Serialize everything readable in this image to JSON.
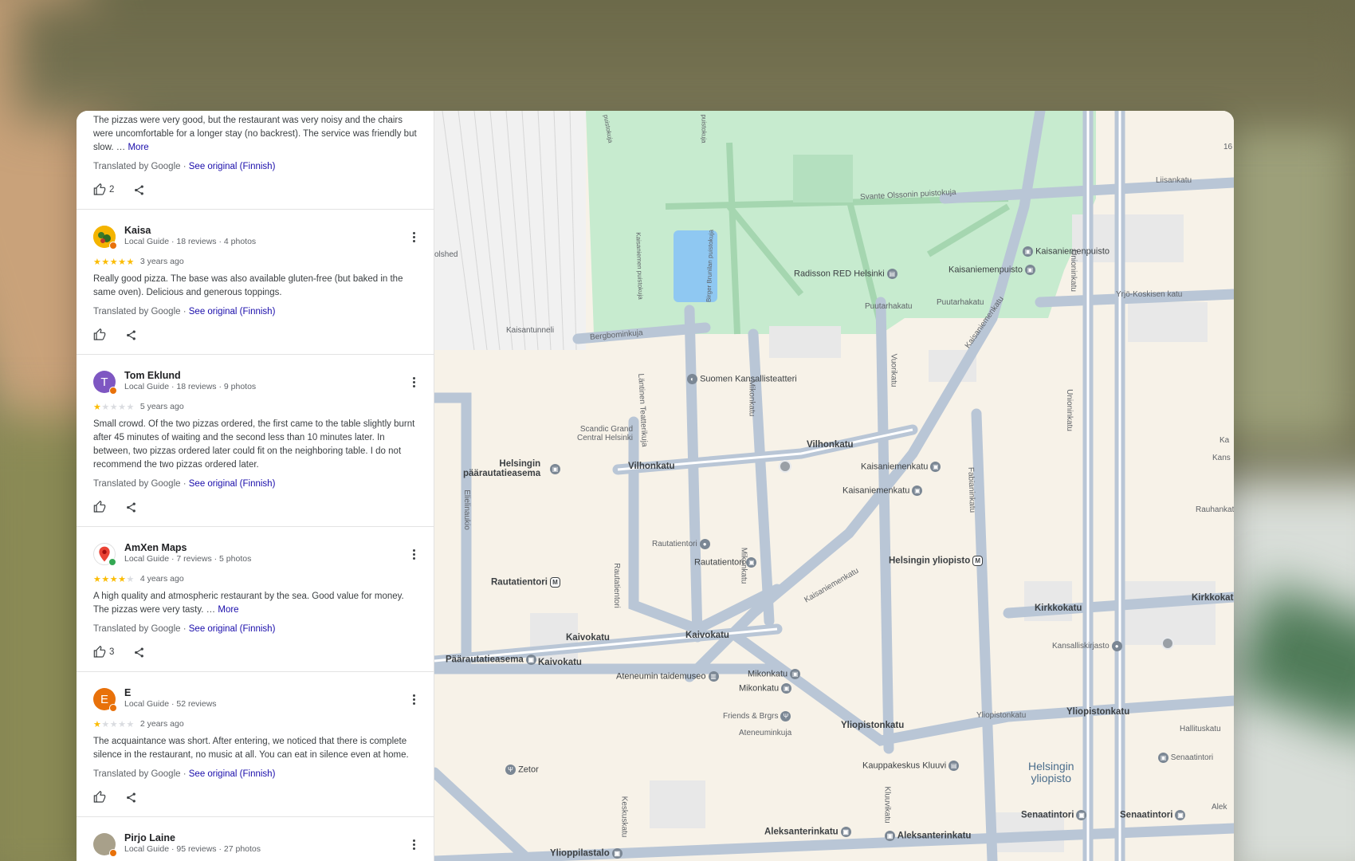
{
  "colors": {
    "accent_link": "#1a0dab",
    "star": "#fbbc04",
    "park": "#c7ebcf",
    "water": "#8fc8f2",
    "road": "#b9c6d6"
  },
  "reviews": [
    {
      "name": "",
      "meta": "",
      "stars": 0,
      "when": "",
      "text": "The pizzas were very good, but the restaurant was very noisy and the chairs were uncomfortable for a longer stay (no backrest). The service was friendly but slow. …",
      "more": "More",
      "translated_prefix": "Translated by Google · ",
      "see_original": "See original (Finnish)",
      "likes": "2"
    },
    {
      "name": "Kaisa",
      "meta": "Local Guide · 18 reviews · 4 photos",
      "stars": 5,
      "when": "3 years ago",
      "text": "Really good pizza. The base was also available gluten-free (but baked in the same oven). Delicious and generous toppings.",
      "more": "",
      "translated_prefix": "Translated by Google · ",
      "see_original": "See original (Finnish)",
      "likes": "",
      "avatar": {
        "letter": "",
        "color": "#f4b400"
      }
    },
    {
      "name": "Tom Eklund",
      "meta": "Local Guide · 18 reviews · 9 photos",
      "stars": 1,
      "when": "5 years ago",
      "text": "Small crowd. Of the two pizzas ordered, the first came to the table slightly burnt after 45 minutes of waiting and the second less than 10 minutes later. In between, two pizzas ordered later could fit on the neighboring table. I do not recommend the two pizzas ordered later.",
      "more": "",
      "translated_prefix": "Translated by Google · ",
      "see_original": "See original (Finnish)",
      "likes": "",
      "avatar": {
        "letter": "T",
        "color": "#7e57c2"
      }
    },
    {
      "name": "AmXen Maps",
      "meta": "Local Guide · 7 reviews · 5 photos",
      "stars": 4,
      "when": "4 years ago",
      "text": "A high quality and atmospheric restaurant by the sea. Good value for money. The pizzas were very tasty. …",
      "more": "More",
      "translated_prefix": "Translated by Google · ",
      "see_original": "See original (Finnish)",
      "likes": "3",
      "avatar": {
        "letter": "",
        "color": "#ffffff"
      }
    },
    {
      "name": "E",
      "meta": "Local Guide · 52 reviews",
      "stars": 1,
      "when": "2 years ago",
      "text": "The acquaintance was short. After entering, we noticed that there is complete silence in the restaurant, no music at all. You can eat in silence even at home.",
      "more": "",
      "translated_prefix": "Translated by Google · ",
      "see_original": "See original (Finnish)",
      "likes": "",
      "avatar": {
        "letter": "E",
        "color": "#e8710a"
      }
    },
    {
      "name": "Pirjo Laine",
      "meta": "Local Guide · 95 reviews · 27 photos",
      "avatar": {
        "letter": "",
        "color": "#a8a08a"
      }
    }
  ],
  "map": {
    "labels": {
      "liisankatu": "Liisankatu",
      "kaisaniemenpuisto": "Kaisaniemenpuisto",
      "kaisaniemenpuisto2": "Kaisaniemenpuisto",
      "svante": "Svante Olssonin puistokuja",
      "radisson": "Radisson RED Helsinki",
      "puutarhakatu": "Puutarhakatu",
      "puutarhakatu2": "Puutarhakatu",
      "yrjo": "Yrjö-Koskisen katu",
      "bergbomin": "Bergbominkuja",
      "kaisantunneli": "Kaisantunneli",
      "olshed": "olshed",
      "lantinen": "Läntinen Teatterikuja",
      "suomen": "Suomen Kansallisteatteri",
      "vuorikatu": "Vuorikatu",
      "mikonkatu": "Mikonkatu",
      "scandic": "Scandic Grand\nCentral Helsinki",
      "vilhonkatu": "Vilhonkatu",
      "vilhonkatu2": "Vilhonkatu",
      "kaisaniemenkatu": "Kaisaniemenkatu",
      "kaisaniemenkatu2": "Kaisaniemenkatu",
      "kaisaniemenkatu_st": "Kaisaniemenkatu",
      "kaisaniemenkatu_st2": "Kaisaniemenkatu",
      "fabianinkatu": "Fabianinkatu",
      "unioninkatu": "Unioninkatu",
      "helsingin_pr": "Helsingin\npäärautatieasema",
      "elielinaukio": "Elielinaukio",
      "rautatientori": "Rautatientori",
      "rautatientori2": "Rautatientori",
      "rautatientori3": "Rautatientori",
      "rautatientori_st": "Rautatientori",
      "mikonkatu2": "Mikonkatu",
      "helsingin_yliopisto": "Helsingin yliopisto",
      "kirkkokatu": "Kirkkokatu",
      "kirkkokatu2": "Kirkkokatu",
      "rauhankatu": "Rauhankatu",
      "kaivokatu": "Kaivokatu",
      "kaivokatu2": "Kaivokatu",
      "kaivokatu3": "Kaivokatu",
      "paarautatieasema": "Päärautatieasema",
      "ateneumin": "Ateneumin taidemuseo",
      "mikonkatu3": "Mikonkatu",
      "mikonkatu4": "Mikonkatu",
      "kansalliskirjasto": "Kansalliskirjasto",
      "friends": "Friends & Brgrs",
      "ateneuminkuja": "Ateneuminkuja",
      "yliopistonkatu": "Yliopistonkatu",
      "yliopistonkatu2": "Yliopistonkatu",
      "yliopistonkatu3": "Yliopistonkatu",
      "hallituskatu": "Hallituskatu",
      "senaatintori": "Senaatintori",
      "senaatintori2": "Senaatintori",
      "senaatintori3": "Senaatintori",
      "zetor": "Zetor",
      "kauppakeskus": "Kauppakeskus Kluuvi",
      "helsingin_area": "Helsingin\nyliopisto",
      "keskuskatu": "Keskuskatu",
      "kluuvikatu": "Kluuvikatu",
      "aleksanterinkatu": "Aleksanterinkatu",
      "aleksanterinkatu2": "Aleksanterinkatu",
      "ylioppilastalo": "Ylioppilastalo",
      "kans": "Kans",
      "ka": "Ka",
      "alek": "Alek",
      "n16": "16",
      "kaisaniemen_puistokuja": "Kaisaniemen puistokuja",
      "birger": "Birger Brunilan puistokuja",
      "puistokuja": "puistokuja",
      "puistokuja2": "puistokuja"
    }
  }
}
